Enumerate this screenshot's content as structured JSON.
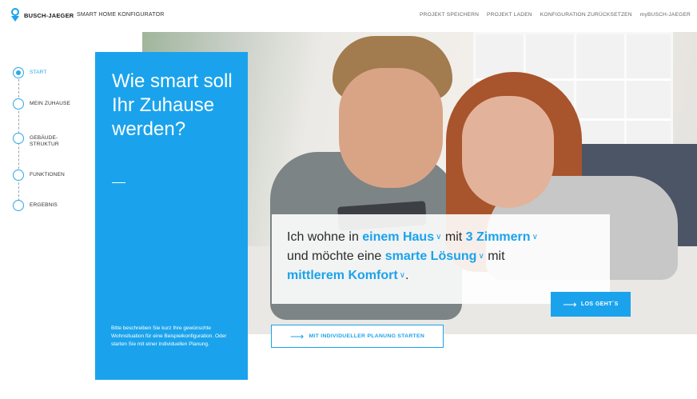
{
  "brand": {
    "name": "BUSCH-JAEGER",
    "app_title": "SMART HOME KONFIGURATOR",
    "accent": "#1aa3ec"
  },
  "nav": [
    {
      "label": "PROJEKT SPEICHERN"
    },
    {
      "label": "PROJEKT LADEN"
    },
    {
      "label": "KONFIGURATION ZURÜCKSETZEN"
    },
    {
      "label": "myBUSCH-JAEGER"
    }
  ],
  "steps": [
    {
      "label": "START",
      "active": true
    },
    {
      "label": "MEIN ZUHAUSE",
      "active": false
    },
    {
      "label": "GEBÄUDE-\nSTRUKTUR",
      "active": false
    },
    {
      "label": "FUNKTIONEN",
      "active": false
    },
    {
      "label": "ERGEBNIS",
      "active": false
    }
  ],
  "panel": {
    "headline": "Wie smart soll Ihr Zuhause werden?",
    "description": "Bitte beschreiben Sie kurz Ihre gewünschte Wohnsituation für eine Beispielkonfiguration. Oder starten Sie mit einer individuellen Planung."
  },
  "sentence": {
    "p1": "Ich wohne in ",
    "house": "einem Haus",
    "p2": " mit ",
    "rooms": "3 Zimmern",
    "p3": "und möchte eine ",
    "solution": "smarte Lösung",
    "p4": " mit",
    "comfort": "mittlerem Komfort",
    "p5": "."
  },
  "buttons": {
    "go": "LOS GEHT´S",
    "plan": "MIT INDIVIDUELLER PLANUNG STARTEN"
  }
}
